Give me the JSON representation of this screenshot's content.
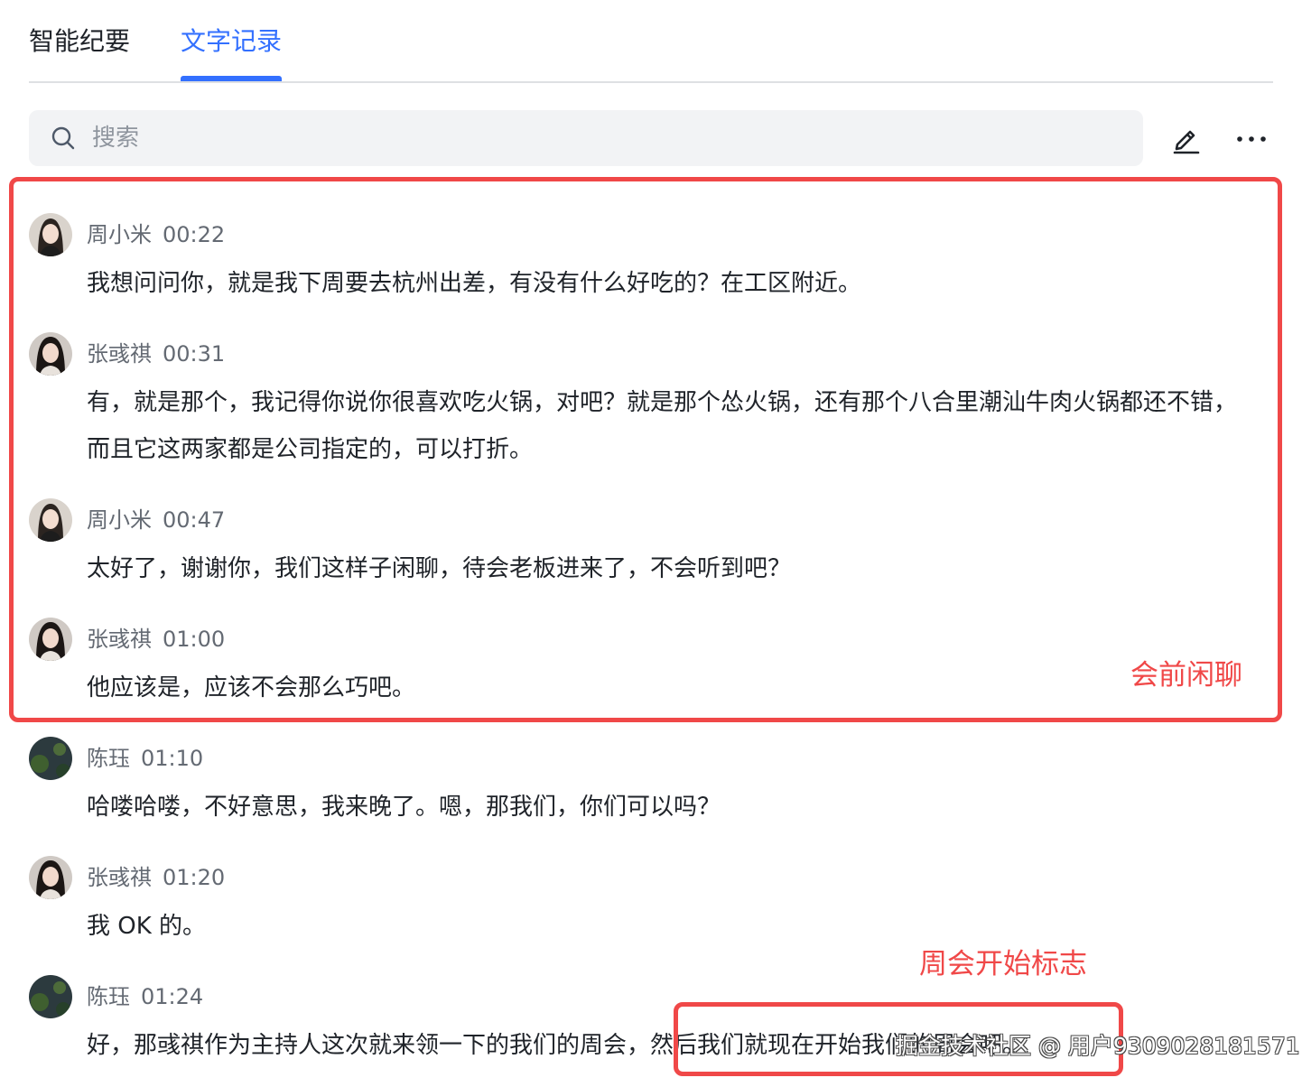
{
  "tabs": [
    {
      "label": "智能纪要",
      "active": false
    },
    {
      "label": "文字记录",
      "active": true
    }
  ],
  "accent_color": "#3370ff",
  "annotation_color": "#f04848",
  "search": {
    "placeholder": "搜索",
    "value": ""
  },
  "toolbar": {
    "edit_icon": "pencil-icon",
    "more_icon": "more-horizontal-icon"
  },
  "entries": [
    {
      "speaker": "周小米",
      "time": "00:22",
      "text": "我想问问你，就是我下周要去杭州出差，有没有什么好吃的？在工区附近。"
    },
    {
      "speaker": "张彧祺",
      "time": "00:31",
      "text": "有，就是那个，我记得你说你很喜欢吃火锅，对吧？就是那个怂火锅，还有那个八合里潮汕牛肉火锅都还不错，而且它这两家都是公司指定的，可以打折。"
    },
    {
      "speaker": "周小米",
      "time": "00:47",
      "text": "太好了，谢谢你，我们这样子闲聊，待会老板进来了，不会听到吧？"
    },
    {
      "speaker": "张彧祺",
      "time": "01:00",
      "text": "他应该是，应该不会那么巧吧。"
    },
    {
      "speaker": "陈珏",
      "time": "01:10",
      "text": "哈喽哈喽，不好意思，我来晚了。嗯，那我们，你们可以吗？"
    },
    {
      "speaker": "张彧祺",
      "time": "01:20",
      "text": "我 OK 的。"
    },
    {
      "speaker": "陈珏",
      "time": "01:24",
      "text": "好，那彧祺作为主持人这次就来领一下的我们的周会，然后我们就现在开始我们的周会吧。"
    }
  ],
  "annotations": {
    "pre_meeting_chat": "会前闲聊",
    "meeting_start_marker": "周会开始标志"
  },
  "watermark": "掘金技术社区 @ 用户9309028181571"
}
